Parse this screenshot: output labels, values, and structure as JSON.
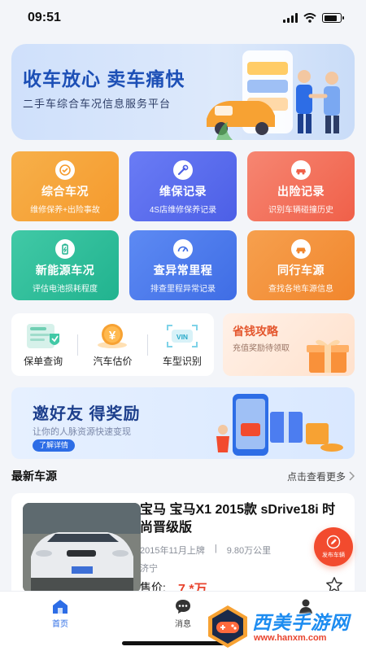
{
  "status": {
    "time": "09:51"
  },
  "banner": {
    "title": "收车放心  卖车痛快",
    "subtitle": "二手车综合车况信息服务平台"
  },
  "services": [
    {
      "title": "综合车况",
      "desc": "维修保养+出险事故",
      "icon": "car-check-icon",
      "color_from": "#f7b04a",
      "color_to": "#f59a2d"
    },
    {
      "title": "维保记录",
      "desc": "4S店维修保养记录",
      "icon": "wrench-icon",
      "color_from": "#6a7cf5",
      "color_to": "#4c5fe6"
    },
    {
      "title": "出险记录",
      "desc": "识别车辆碰撞历史",
      "icon": "crashed-car-icon",
      "color_from": "#f68672",
      "color_to": "#f06049"
    },
    {
      "title": "新能源车况",
      "desc": "评估电池损耗程度",
      "icon": "battery-icon",
      "color_from": "#41c9a6",
      "color_to": "#21b38f"
    },
    {
      "title": "查异常里程",
      "desc": "排查里程异常记录",
      "icon": "speedometer-icon",
      "color_from": "#5d8af3",
      "color_to": "#3f6de5"
    },
    {
      "title": "同行车源",
      "desc": "查找各地车源信息",
      "icon": "car-icon",
      "color_from": "#f6a04e",
      "color_to": "#f1862d"
    }
  ],
  "tools": [
    {
      "label": "保单查询",
      "icon": "policy-icon"
    },
    {
      "label": "汽车估价",
      "icon": "yen-icon"
    },
    {
      "label": "车型识别",
      "icon": "vin-icon"
    }
  ],
  "promo": {
    "title": "省钱攻略",
    "subtitle": "充值奖励待领取"
  },
  "invite": {
    "title": "邀好友  得奖励",
    "subtitle": "让你的人脉资源快速变现",
    "button": "了解详情"
  },
  "section": {
    "title": "最新车源",
    "more": "点击查看更多"
  },
  "listing": {
    "title": "宝马 宝马X1 2015款 sDrive18i 时尚晋级版",
    "date": "2015年11月上牌",
    "mileage": "9.80万公里",
    "location": "济宁",
    "price_label": "售价:",
    "price": "7.*万"
  },
  "fab": {
    "label": "发布车辆"
  },
  "tabs": [
    {
      "label": "首页",
      "active": true
    },
    {
      "label": "消息",
      "active": false
    }
  ],
  "watermark": {
    "title": "西美手游网",
    "url": "www.hanxm.com"
  }
}
